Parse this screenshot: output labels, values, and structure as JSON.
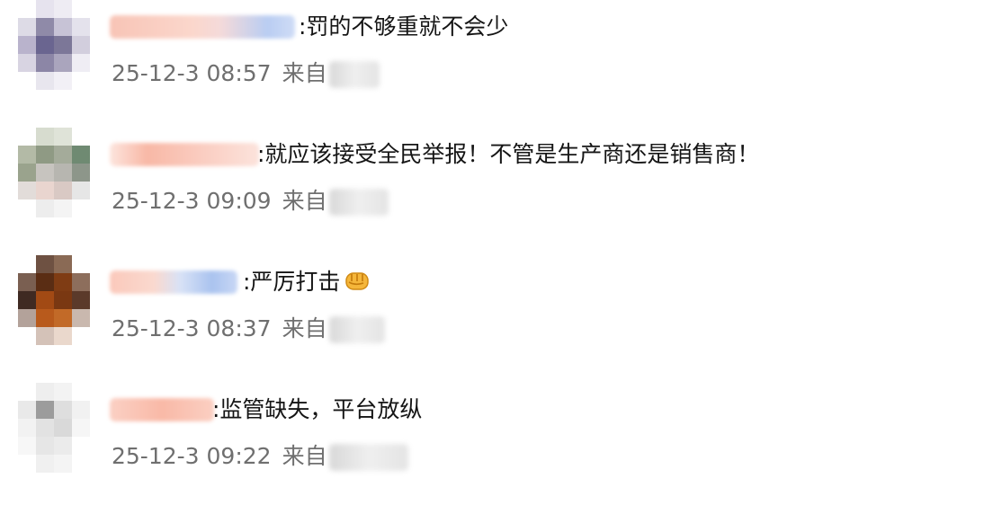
{
  "comments": [
    {
      "text": ":罚的不够重就不会少",
      "timestamp": "25-12-3 08:57",
      "source_prefix": "来自"
    },
    {
      "text": ":就应该接受全民举报！不管是生产商还是销售商！",
      "timestamp": "25-12-3 09:09",
      "source_prefix": "来自"
    },
    {
      "text": ":严厉打击",
      "emoji": "oncoming-fist-icon",
      "timestamp": "25-12-3 08:37",
      "source_prefix": "来自"
    },
    {
      "text": ":监管缺失，平台放纵",
      "timestamp": "25-12-3 09:22",
      "source_prefix": "来自"
    }
  ],
  "colors": {
    "comment_text": "#151515",
    "meta_text": "#6f6f6f",
    "username_pink": "#f8b8a6",
    "username_blue": "#aac3ef",
    "fist": "#f5b63a"
  }
}
